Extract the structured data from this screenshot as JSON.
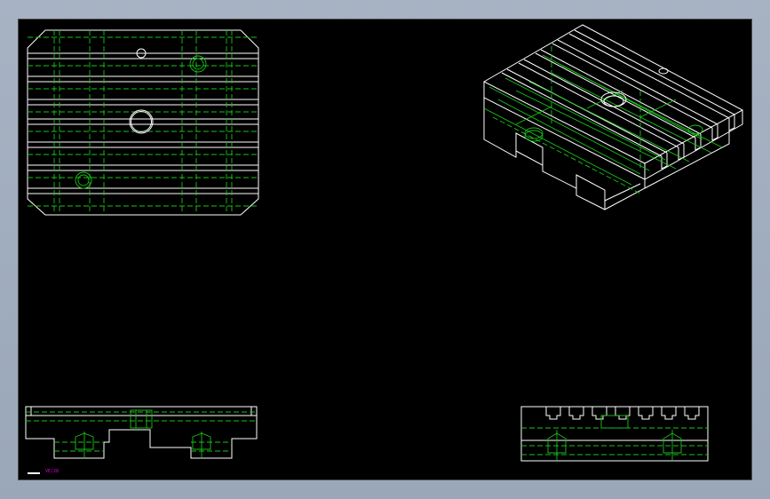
{
  "drawing": {
    "label_tag": "VE/28",
    "colors": {
      "background": "#000000",
      "outline": "#ffffff",
      "hidden_lines": "#19c219",
      "tag": "#e000e0",
      "frame": "#a7b3c3"
    }
  }
}
